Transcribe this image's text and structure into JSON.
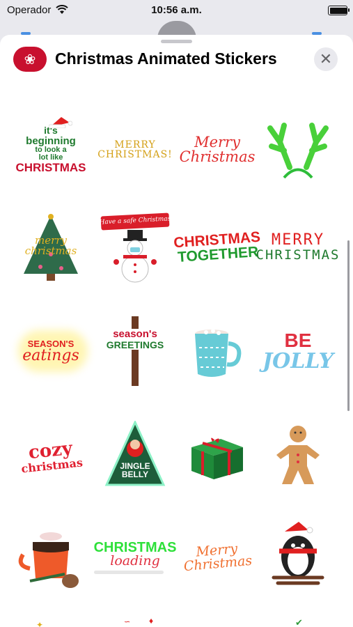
{
  "status_bar": {
    "carrier": "Operador",
    "time": "10:56 a.m.",
    "battery_level": 0.95
  },
  "header": {
    "title": "Christmas Animated Stickers",
    "close_icon": "close-icon"
  },
  "stickers": [
    {
      "lines": [
        "it's",
        "beginning",
        "to look a",
        "lot like",
        "CHRISTMAS"
      ],
      "colors": [
        "#1f7a2e",
        "#1f7a2e",
        "#1f7a2e",
        "#1f7a2e",
        "#c8102e"
      ]
    },
    {
      "lines": [
        "MERRY",
        "CHRISTMAS!"
      ],
      "colors": [
        "#d4a017",
        "#d4a017"
      ]
    },
    {
      "lines": [
        "Merry",
        "Christmas"
      ],
      "colors": [
        "#e02f2f",
        "#e02f2f"
      ]
    },
    {
      "lines": [],
      "colors": []
    },
    {
      "lines": [
        "merry",
        "christmas"
      ],
      "colors": [
        "#e0b020",
        "#e0b020"
      ]
    },
    {
      "lines": [
        "Have a safe Christmas"
      ],
      "colors": [
        "#ffffff"
      ]
    },
    {
      "lines": [
        "CHRISTMAS",
        "TOGETHER"
      ],
      "colors": [
        "#e02020",
        "#1f9a2e"
      ]
    },
    {
      "lines": [
        "MERRY",
        "CHRISTMAS"
      ],
      "colors": [
        "#e02020",
        "#1f7a2e"
      ]
    },
    {
      "lines": [
        "SEASON'S",
        "eatings"
      ],
      "colors": [
        "#e02020",
        "#e02020"
      ]
    },
    {
      "lines": [
        "season's",
        "GREETINGS"
      ],
      "colors": [
        "#c8102e",
        "#1f7a2e"
      ]
    },
    {
      "lines": [],
      "colors": []
    },
    {
      "lines": [
        "BE",
        "JOLLY"
      ],
      "colors": [
        "#e03040",
        "#78c6e8"
      ]
    },
    {
      "lines": [
        "cozy",
        "christmas"
      ],
      "colors": [
        "#e02030",
        "#e02030"
      ]
    },
    {
      "lines": [
        "JINGLE",
        "BELLY"
      ],
      "colors": [
        "#ffffff",
        "#ffffff"
      ]
    },
    {
      "lines": [],
      "colors": []
    },
    {
      "lines": [],
      "colors": []
    },
    {
      "lines": [],
      "colors": []
    },
    {
      "lines": [
        "CHRISTMAS",
        "loading"
      ],
      "colors": [
        "#2ee03a",
        "#e03040"
      ]
    },
    {
      "lines": [
        "Merry",
        "Christmas"
      ],
      "colors": [
        "#f07030",
        "#f07030"
      ]
    },
    {
      "lines": [],
      "colors": []
    }
  ]
}
